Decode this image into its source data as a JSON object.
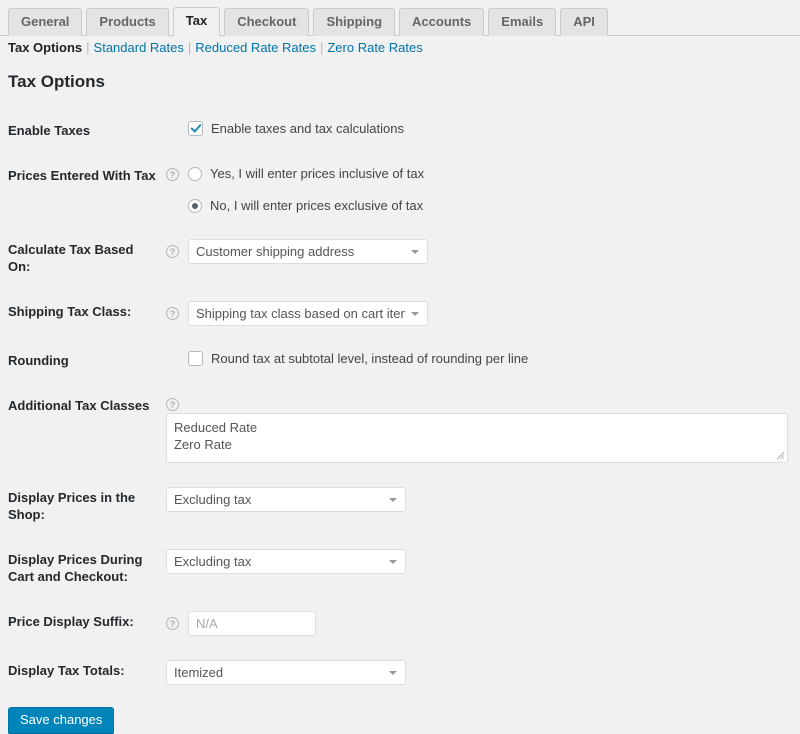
{
  "tabs": [
    {
      "label": "General",
      "active": false
    },
    {
      "label": "Products",
      "active": false
    },
    {
      "label": "Tax",
      "active": true
    },
    {
      "label": "Checkout",
      "active": false
    },
    {
      "label": "Shipping",
      "active": false
    },
    {
      "label": "Accounts",
      "active": false
    },
    {
      "label": "Emails",
      "active": false
    },
    {
      "label": "API",
      "active": false
    }
  ],
  "subnav": {
    "current": "Tax Options",
    "links": [
      "Standard Rates",
      "Reduced Rate Rates",
      "Zero Rate Rates"
    ],
    "separator": "|"
  },
  "page_title": "Tax Options",
  "help_icon_glyph": "?",
  "rows": {
    "enable_taxes": {
      "label": "Enable Taxes",
      "checkbox_label": "Enable taxes and tax calculations",
      "checked": true
    },
    "prices_entered_with_tax": {
      "label": "Prices Entered With Tax",
      "option_yes": "Yes, I will enter prices inclusive of tax",
      "option_no": "No, I will enter prices exclusive of tax",
      "selected": "no"
    },
    "calculate_tax_based_on": {
      "label": "Calculate Tax Based On:",
      "value": "Customer shipping address"
    },
    "shipping_tax_class": {
      "label": "Shipping Tax Class:",
      "value": "Shipping tax class based on cart items"
    },
    "rounding": {
      "label": "Rounding",
      "checkbox_label": "Round tax at subtotal level, instead of rounding per line",
      "checked": false
    },
    "additional_tax_classes": {
      "label": "Additional Tax Classes",
      "value": "Reduced Rate\nZero Rate"
    },
    "display_prices_shop": {
      "label": "Display Prices in the Shop:",
      "value": "Excluding tax"
    },
    "display_prices_cart": {
      "label": "Display Prices During Cart and Checkout:",
      "value": "Excluding tax"
    },
    "price_display_suffix": {
      "label": "Price Display Suffix:",
      "value": "",
      "placeholder": "N/A"
    },
    "display_tax_totals": {
      "label": "Display Tax Totals:",
      "value": "Itemized"
    }
  },
  "save_button": "Save changes",
  "colors": {
    "page_bg": "#f1f1f1",
    "link": "#0073aa",
    "primary_button": "#0085ba",
    "checkmark": "#1e8cbe",
    "radio_dot": "#55606b"
  }
}
